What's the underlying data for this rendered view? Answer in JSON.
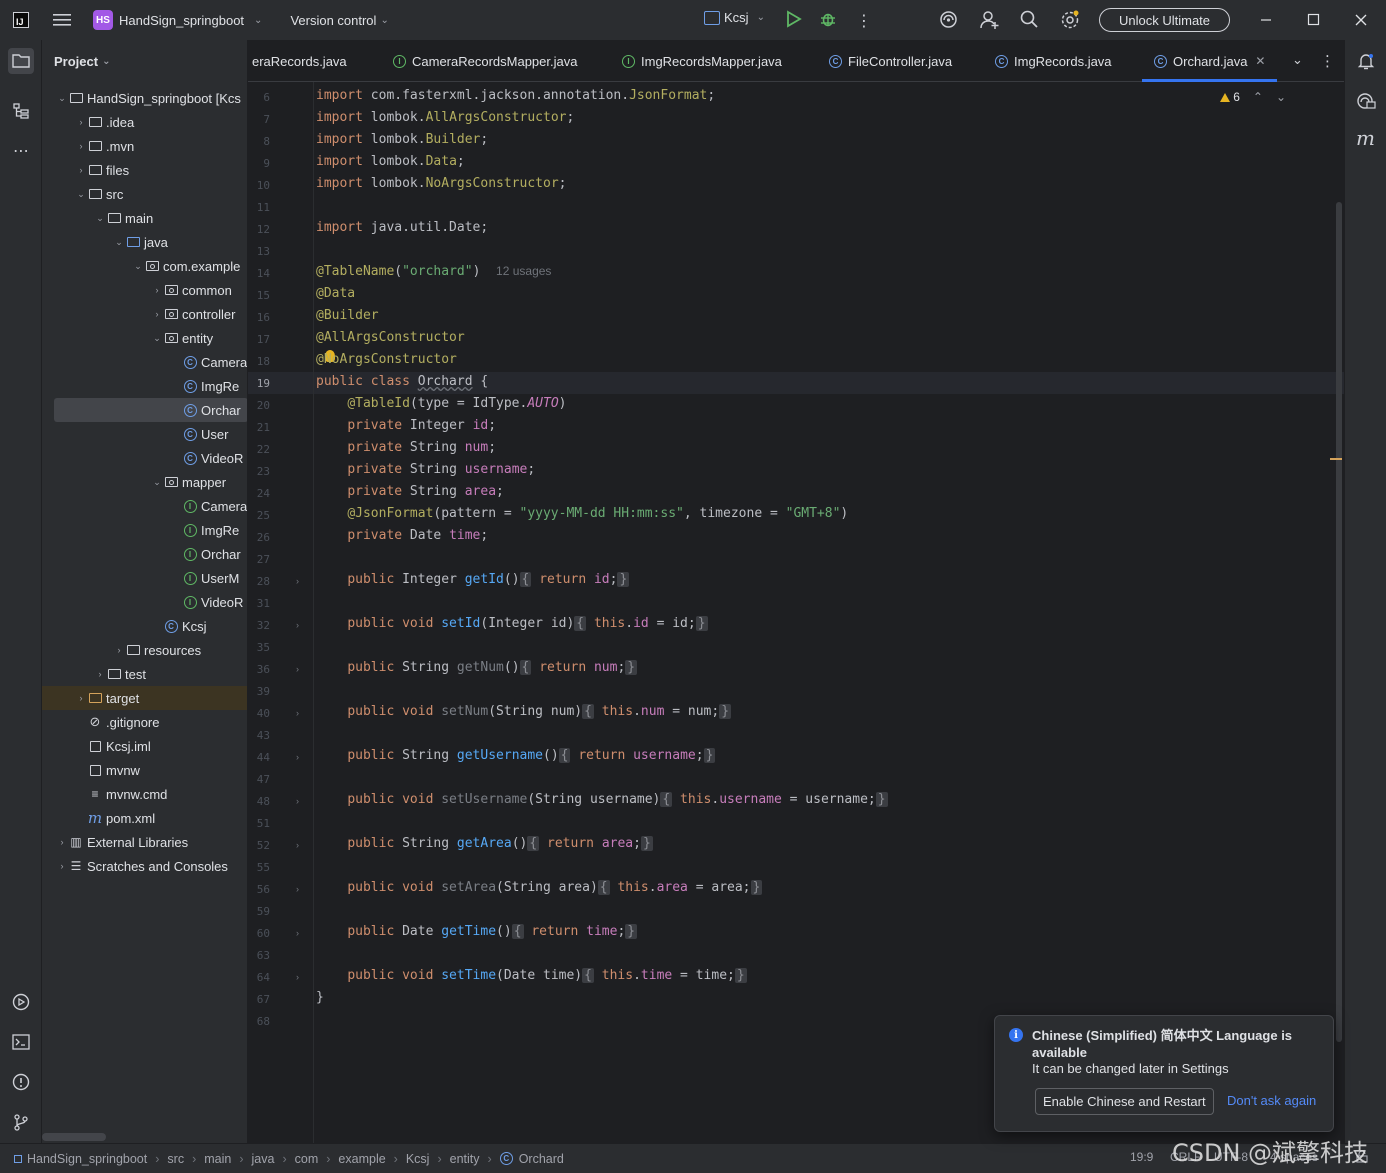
{
  "titlebar": {
    "project_badge": "HS",
    "project_name": "HandSign_springboot",
    "version_control": "Version control",
    "run_config": "Kcsj",
    "unlock": "Unlock Ultimate"
  },
  "project_panel": {
    "title": "Project",
    "tree": [
      {
        "label": "HandSign_springboot [Kcs",
        "icon": "folder-icon",
        "arrow": "⌄",
        "level": 0
      },
      {
        "label": ".idea",
        "icon": "folder-icon",
        "arrow": "›",
        "level": 1
      },
      {
        "label": ".mvn",
        "icon": "folder-icon",
        "arrow": "›",
        "level": 1
      },
      {
        "label": "files",
        "icon": "folder-icon",
        "arrow": "›",
        "level": 1
      },
      {
        "label": "src",
        "icon": "folder-icon",
        "arrow": "⌄",
        "level": 1
      },
      {
        "label": "main",
        "icon": "folder-icon",
        "arrow": "⌄",
        "level": 2
      },
      {
        "label": "java",
        "icon": "folder-icon",
        "arrow": "⌄",
        "level": 3
      },
      {
        "label": "com.example",
        "icon": "package-icon",
        "arrow": "⌄",
        "level": 4
      },
      {
        "label": "common",
        "icon": "package-icon",
        "arrow": "›",
        "level": 5
      },
      {
        "label": "controller",
        "icon": "package-icon",
        "arrow": "›",
        "level": 5
      },
      {
        "label": "entity",
        "icon": "package-icon",
        "arrow": "⌄",
        "level": 5
      },
      {
        "label": "Camera",
        "icon": "class-icon",
        "arrow": "",
        "level": 6
      },
      {
        "label": "ImgRe",
        "icon": "class-icon",
        "arrow": "",
        "level": 6
      },
      {
        "label": "Orchar",
        "icon": "class-icon",
        "arrow": "",
        "level": 6
      },
      {
        "label": "User",
        "icon": "class-icon",
        "arrow": "",
        "level": 6
      },
      {
        "label": "VideoR",
        "icon": "class-icon",
        "arrow": "",
        "level": 6
      },
      {
        "label": "mapper",
        "icon": "package-icon",
        "arrow": "⌄",
        "level": 5
      },
      {
        "label": "Camera",
        "icon": "interface-icon",
        "arrow": "",
        "level": 6
      },
      {
        "label": "ImgRe",
        "icon": "interface-icon",
        "arrow": "",
        "level": 6
      },
      {
        "label": "Orchar",
        "icon": "interface-icon",
        "arrow": "",
        "level": 6
      },
      {
        "label": "UserM",
        "icon": "interface-icon",
        "arrow": "",
        "level": 6
      },
      {
        "label": "VideoR",
        "icon": "interface-icon",
        "arrow": "",
        "level": 6
      },
      {
        "label": "Kcsj",
        "icon": "app-class-icon",
        "arrow": "",
        "level": 5
      },
      {
        "label": "resources",
        "icon": "folder-icon",
        "arrow": "›",
        "level": 3
      },
      {
        "label": "test",
        "icon": "folder-icon",
        "arrow": "›",
        "level": 2
      },
      {
        "label": "target",
        "icon": "folder-icon",
        "arrow": "›",
        "level": 1
      },
      {
        "label": ".gitignore",
        "icon": "ignore-file-icon",
        "arrow": "",
        "level": 1
      },
      {
        "label": "Kcsj.iml",
        "icon": "iml-file-icon",
        "arrow": "",
        "level": 1
      },
      {
        "label": "mvnw",
        "icon": "terminal-file-icon",
        "arrow": "",
        "level": 1
      },
      {
        "label": "mvnw.cmd",
        "icon": "text-file-icon",
        "arrow": "",
        "level": 1
      },
      {
        "label": "pom.xml",
        "icon": "maven-icon",
        "arrow": "",
        "level": 1
      },
      {
        "label": "External Libraries",
        "icon": "library-icon",
        "arrow": "›",
        "level": 0
      },
      {
        "label": "Scratches and Consoles",
        "icon": "scratches-icon",
        "arrow": "›",
        "level": 0
      }
    ]
  },
  "tabs": [
    {
      "label": "eraRecords.java",
      "icon": "class-icon"
    },
    {
      "label": "CameraRecordsMapper.java",
      "icon": "interface-icon"
    },
    {
      "label": "ImgRecordsMapper.java",
      "icon": "interface-icon"
    },
    {
      "label": "FileController.java",
      "icon": "class-icon"
    },
    {
      "label": "ImgRecords.java",
      "icon": "class-icon"
    },
    {
      "label": "Orchard.java",
      "icon": "class-icon"
    }
  ],
  "editor": {
    "warnings": "6",
    "line_numbers": [
      "6",
      "7",
      "8",
      "9",
      "10",
      "11",
      "12",
      "13",
      "14",
      "15",
      "16",
      "17",
      "18",
      "19",
      "20",
      "21",
      "22",
      "23",
      "24",
      "25",
      "26",
      "27",
      "28",
      "31",
      "32",
      "35",
      "36",
      "39",
      "40",
      "43",
      "44",
      "47",
      "48",
      "51",
      "52",
      "55",
      "56",
      "59",
      "60",
      "63",
      "64",
      "67",
      "68"
    ],
    "usages": "12 usages"
  },
  "status": {
    "breadcrumbs": [
      "HandSign_springboot",
      "src",
      "main",
      "java",
      "com",
      "example",
      "Kcsj",
      "entity",
      "Orchard"
    ],
    "position": "19:9",
    "line_sep": "CRLF",
    "encoding": "UTF-8",
    "indent": "4 spaces"
  },
  "notification": {
    "title": "Chinese (Simplified) 简体中文 Language is available",
    "subtitle": "It can be changed later in Settings",
    "button": "Enable Chinese and Restart",
    "link": "Don't ask again"
  },
  "watermark": "CSDN @斌擎科技"
}
